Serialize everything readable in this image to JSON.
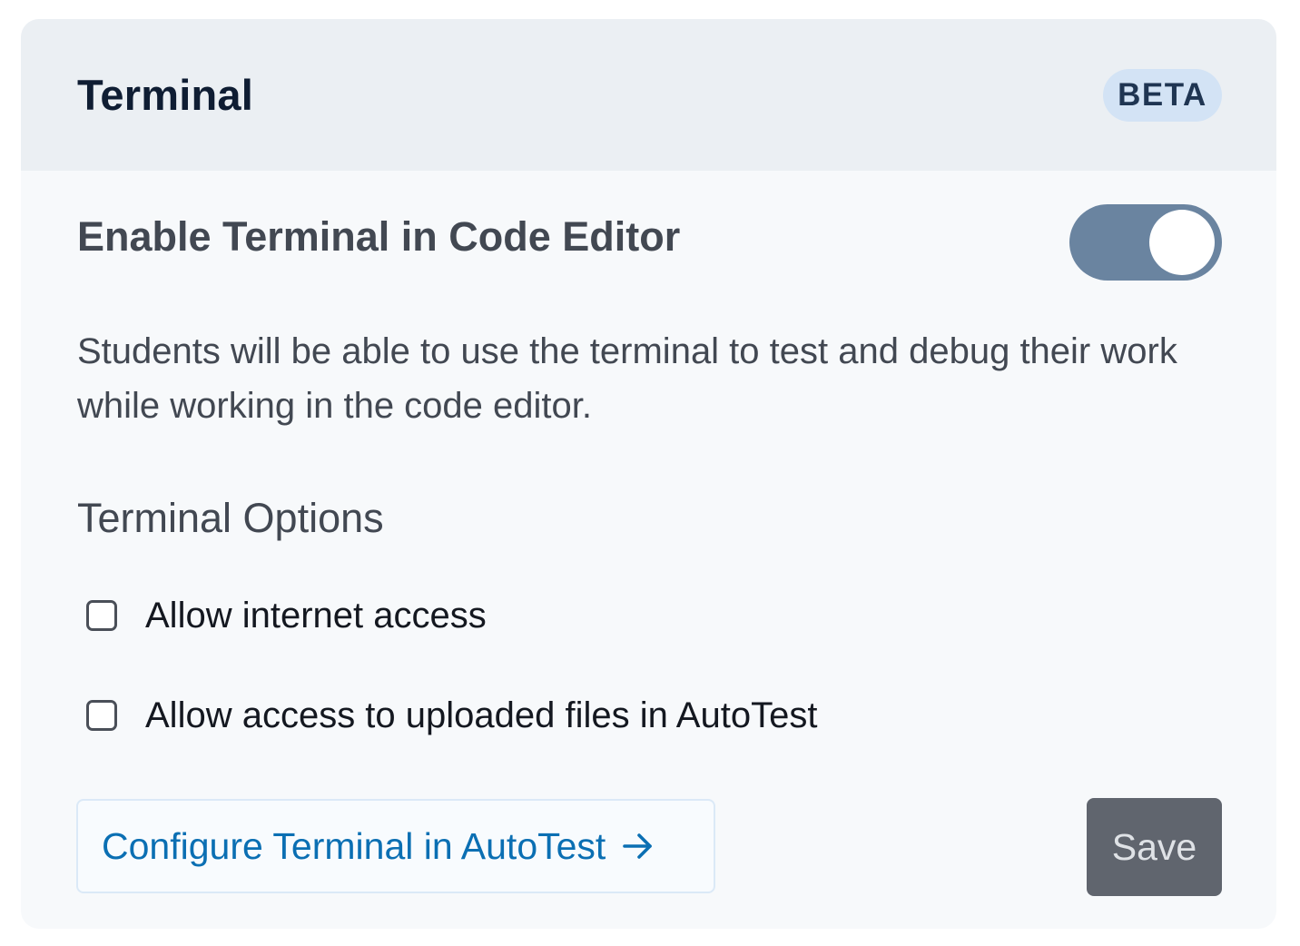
{
  "panel": {
    "title": "Terminal",
    "badge": "BETA"
  },
  "enable_setting": {
    "label": "Enable Terminal in Code Editor",
    "enabled": true,
    "description": "Students will be able to use the terminal to test and debug their work while working in the code editor."
  },
  "options": {
    "title": "Terminal Options",
    "items": [
      {
        "label": "Allow internet access",
        "checked": false
      },
      {
        "label": "Allow access to uploaded files in AutoTest",
        "checked": false
      }
    ]
  },
  "actions": {
    "configure_label": "Configure Terminal in AutoTest",
    "configure_icon": "arrow-right-icon",
    "save_label": "Save"
  },
  "colors": {
    "toggle_on": "#6a84a0",
    "link": "#0b6fb3",
    "save_button": "#60656e",
    "badge_bg": "#d3e3f5"
  }
}
